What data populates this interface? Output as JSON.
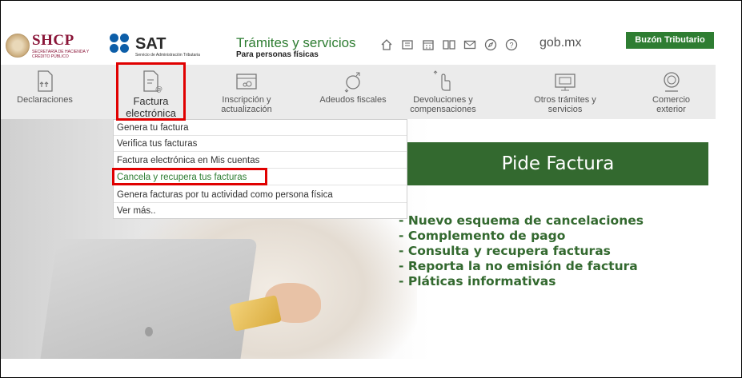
{
  "header": {
    "shcp_logo": "SHCP",
    "shcp_subtitle": "SECRETARÍA DE HACIENDA Y CRÉDITO PÚBLICO",
    "sat_logo": "SAT",
    "sat_subtitle": "Servicio de Administración Tributaria",
    "title": "Trámites y servicios",
    "subtitle": "Para personas físicas",
    "icons": [
      "home-icon",
      "document-icon",
      "calendar-icon",
      "book-icon",
      "mail-icon",
      "compass-icon",
      "help-icon"
    ],
    "gob_link": "gob.mx",
    "buzon_button": "Buzón Tributario"
  },
  "nav": {
    "items": [
      {
        "label": "Declaraciones",
        "icon": "declaraciones-icon"
      },
      {
        "label": "Factura electrónica",
        "icon": "factura-icon"
      },
      {
        "label": "Inscripción y actualización",
        "icon": "inscripcion-icon"
      },
      {
        "label": "Adeudos fiscales",
        "icon": "adeudos-icon"
      },
      {
        "label": "Devoluciones y compensaciones",
        "icon": "devoluciones-icon"
      },
      {
        "label": "Otros trámites y servicios",
        "icon": "otros-icon"
      },
      {
        "label": "Comercio exterior",
        "icon": "comercio-icon"
      }
    ]
  },
  "dropdown": {
    "items": [
      "Genera tu factura",
      "Verifica tus facturas",
      "Factura electrónica en Mis cuentas",
      "Cancela y recupera tus facturas",
      "Genera facturas por tu actividad como persona física",
      "Ver más.."
    ],
    "highlighted_index": 3
  },
  "hero": {
    "banner": "Pide Factura",
    "bullets": [
      "- Nuevo esquema de cancelaciones",
      "- Complemento de pago",
      "- Consulta y recupera facturas",
      "- Reporta la no emisión de factura",
      "- Pláticas informativas"
    ]
  },
  "colors": {
    "brand_green": "#33692f",
    "highlight_red": "#e00000",
    "shcp_wine": "#8a1538",
    "sat_blue": "#0d5ea8"
  }
}
